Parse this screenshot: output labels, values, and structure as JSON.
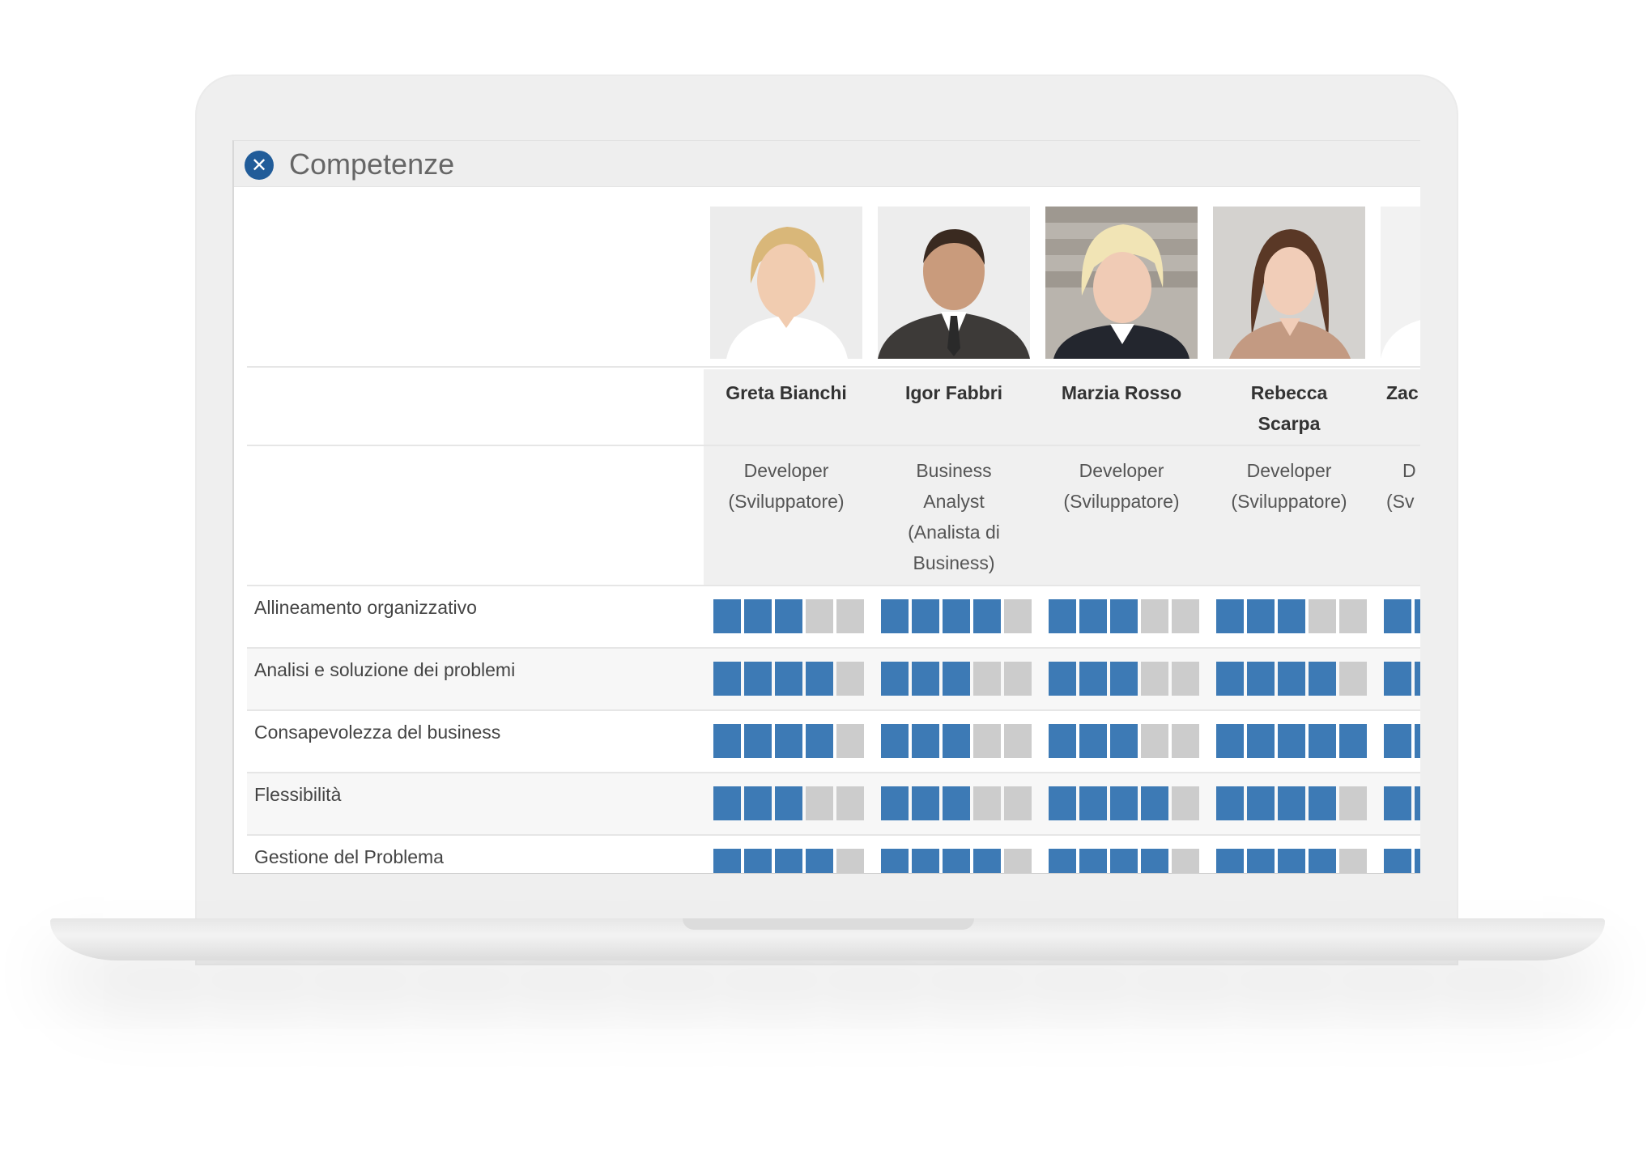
{
  "window": {
    "title": "Competenze",
    "close_icon": "close-circle-icon",
    "accent": "#215c99"
  },
  "colors": {
    "rating_filled": "#3d7ab5",
    "rating_empty": "#cccccc"
  },
  "rating_max": 5,
  "people": [
    {
      "name": "Greta Bianchi",
      "role": "Developer (Sviluppatore)",
      "role_lines": [
        "Developer",
        "(Sviluppatore)"
      ]
    },
    {
      "name": "Igor Fabbri",
      "role": "Business Analyst (Analista di Business)",
      "role_lines": [
        "Business",
        "Analyst",
        "(Analista di",
        "Business)"
      ]
    },
    {
      "name": "Marzia Rosso",
      "role": "Developer (Sviluppatore)",
      "role_lines": [
        "Developer",
        "(Sviluppatore)"
      ]
    },
    {
      "name": "Rebecca Scarpa",
      "role": "Developer (Sviluppatore)",
      "role_lines": [
        "Developer",
        "(Sviluppatore)"
      ]
    },
    {
      "name": "Zac",
      "role": "D (Sv",
      "role_lines": [
        "D",
        "(Sv"
      ]
    }
  ],
  "skills": [
    {
      "label": "Allineamento organizzativo",
      "ratings": [
        3,
        4,
        3,
        3,
        2
      ]
    },
    {
      "label": "Analisi e soluzione dei problemi",
      "ratings": [
        4,
        3,
        3,
        4,
        2
      ]
    },
    {
      "label": "Consapevolezza del business",
      "ratings": [
        4,
        3,
        3,
        5,
        2
      ]
    },
    {
      "label": "Flessibilità",
      "ratings": [
        3,
        3,
        4,
        4,
        2
      ]
    },
    {
      "label": "Gestione del Problema",
      "ratings": [
        4,
        4,
        4,
        4,
        2
      ]
    }
  ]
}
